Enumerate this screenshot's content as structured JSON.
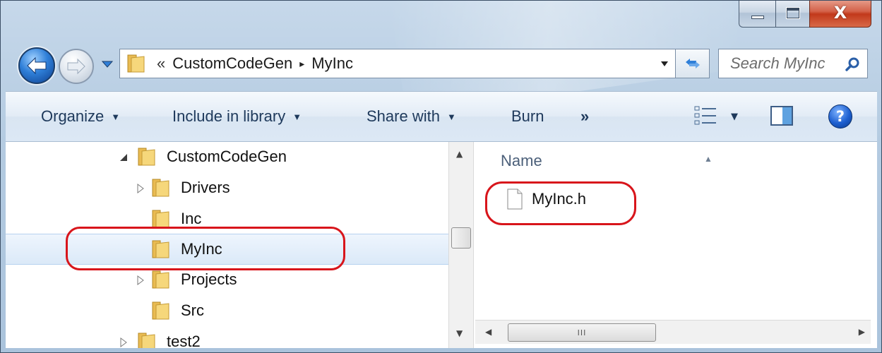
{
  "window": {
    "caption": {
      "minimize_icon": "minimize-icon",
      "maximize_icon": "maximize-icon",
      "close_glyph": "X"
    }
  },
  "nav": {
    "back_icon": "back-arrow-icon",
    "forward_icon": "forward-arrow-icon",
    "address": {
      "overflow": "«",
      "crumbs": [
        "CustomCodeGen",
        "MyInc"
      ],
      "separator": "▸"
    },
    "refresh_icon": "refresh-icon",
    "search_placeholder": "Search MyInc"
  },
  "toolbar": {
    "organize": "Organize",
    "include_in_library": "Include in library",
    "share_with": "Share with",
    "burn": "Burn",
    "more": "»",
    "help": "?"
  },
  "tree": {
    "items": [
      {
        "label": "CustomCodeGen",
        "expander": "expanded",
        "level": 0
      },
      {
        "label": "Drivers",
        "expander": "collapsed",
        "level": 1
      },
      {
        "label": "Inc",
        "expander": "none",
        "level": 1
      },
      {
        "label": "MyInc",
        "expander": "none",
        "level": 1,
        "selected": true
      },
      {
        "label": "Projects",
        "expander": "collapsed",
        "level": 1
      },
      {
        "label": "Src",
        "expander": "none",
        "level": 1
      },
      {
        "label": "test2",
        "expander": "collapsed",
        "level": 0
      }
    ]
  },
  "files": {
    "column_header": "Name",
    "items": [
      {
        "name": "MyInc.h",
        "icon": "header-file-icon"
      }
    ]
  },
  "scrollbar": {
    "grip": "III"
  },
  "colors": {
    "annotation": "#d8151b",
    "toolbar_text": "#1e395b",
    "selection": "#dbe9f8"
  }
}
